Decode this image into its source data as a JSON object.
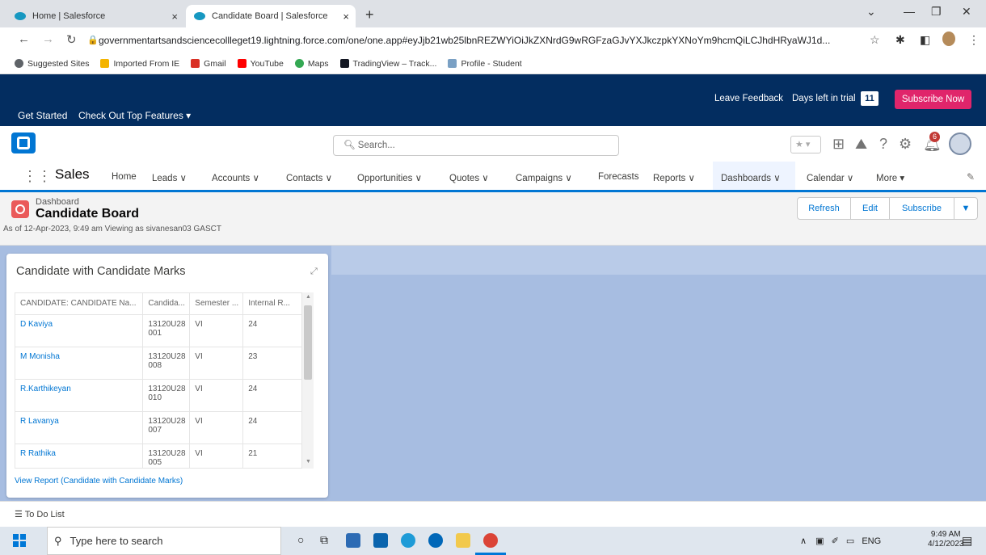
{
  "browser": {
    "tabs": [
      {
        "title": "Home | Salesforce",
        "close": "×"
      },
      {
        "title": "Candidate Board | Salesforce",
        "close": "×"
      }
    ],
    "new_tab": "+",
    "url": "governmentartsandsciencecollleget19.lightning.force.com/one/one.app#eyJjb21wb25lbnREZWYiOiJkZXNrdG9wRGFzaGJvYXJkczpkYXNoYm9hcmQiLCJhdHRyaWJ1d...",
    "bookmarks": [
      {
        "label": "Suggested Sites",
        "color": "#5f6368"
      },
      {
        "label": "Imported From IE",
        "color": "#f4b400"
      },
      {
        "label": "Gmail",
        "color": "#d93025"
      },
      {
        "label": "YouTube",
        "color": "#ff0000"
      },
      {
        "label": "Maps",
        "color": "#34a853"
      },
      {
        "label": "TradingView – Track...",
        "color": "#131722"
      },
      {
        "label": "Profile - Student",
        "color": "#7aa0c4"
      }
    ]
  },
  "trial": {
    "get_started": "Get Started",
    "top_features": "Check Out Top Features ▾",
    "feedback": "Leave Feedback",
    "days_left_label": "Days left in trial",
    "days_left": "11",
    "subscribe": "Subscribe Now"
  },
  "header": {
    "search_placeholder": "Search...",
    "notification_count": "6"
  },
  "nav": {
    "app_name": "Sales",
    "items": [
      {
        "label": "Home"
      },
      {
        "label": "Leads ∨"
      },
      {
        "label": "Accounts ∨"
      },
      {
        "label": "Contacts ∨"
      },
      {
        "label": "Opportunities ∨"
      },
      {
        "label": "Quotes ∨"
      },
      {
        "label": "Campaigns ∨"
      },
      {
        "label": "Forecasts"
      },
      {
        "label": "Reports ∨"
      },
      {
        "label": "Dashboards ∨"
      },
      {
        "label": "Calendar ∨"
      },
      {
        "label": "More ▾"
      }
    ]
  },
  "dashboard": {
    "label": "Dashboard",
    "title": "Candidate Board",
    "subtitle": "As of 12-Apr-2023, 9:49 am Viewing as sivanesan03 GASCT",
    "buttons": {
      "refresh": "Refresh",
      "edit": "Edit",
      "subscribe": "Subscribe"
    }
  },
  "card": {
    "title": "Candidate with Candidate Marks",
    "columns": [
      "CANDIDATE: CANDIDATE Na...",
      "Candida...",
      "Semester ...",
      "Internal R..."
    ],
    "rows": [
      {
        "name": "D Kaviya",
        "id1": "13120U28",
        "id2": "001",
        "sem": "VI",
        "mark": "24"
      },
      {
        "name": "M Monisha",
        "id1": "13120U28",
        "id2": "008",
        "sem": "VI",
        "mark": "23"
      },
      {
        "name": "R.Karthikeyan",
        "id1": "13120U28",
        "id2": "010",
        "sem": "VI",
        "mark": "24"
      },
      {
        "name": "R Lavanya",
        "id1": "13120U28",
        "id2": "007",
        "sem": "VI",
        "mark": "24"
      },
      {
        "name": "R Rathika",
        "id1": "13120U28",
        "id2": "005",
        "sem": "VI",
        "mark": "21"
      }
    ],
    "view_report": "View Report (Candidate with Candidate Marks)"
  },
  "todo": {
    "label": "To Do List"
  },
  "taskbar": {
    "search_placeholder": "Type here to search",
    "lang": "ENG",
    "time": "9:49 AM",
    "date": "4/12/2023"
  }
}
